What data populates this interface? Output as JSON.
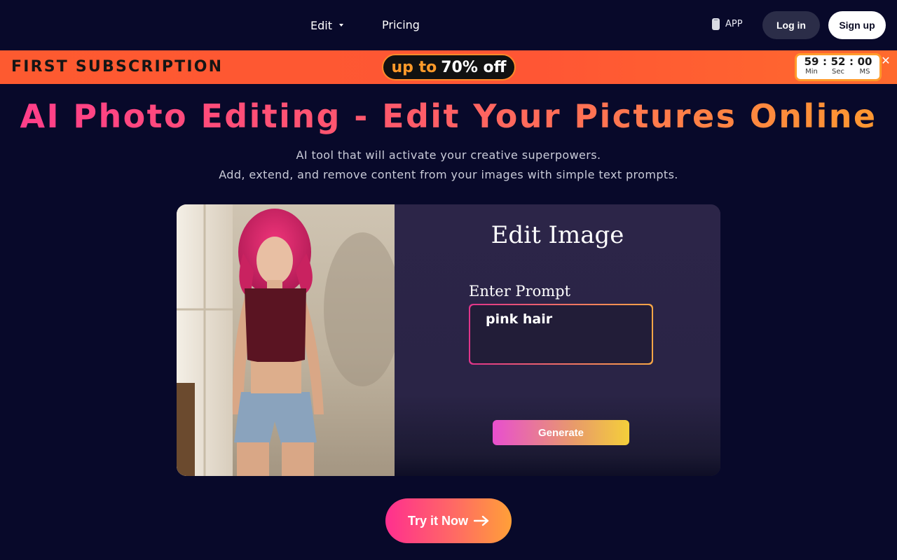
{
  "nav": {
    "edit_label": "Edit",
    "pricing_label": "Pricing",
    "app_label": "APP",
    "login_label": "Log in",
    "signup_label": "Sign up"
  },
  "promo": {
    "title": "FIRST SUBSCRIPTION",
    "pill_prefix": "up to",
    "pill_offer": "70% off",
    "timer": {
      "min": "59",
      "sec": "52",
      "ms": "00",
      "min_label": "Min",
      "sec_label": "Sec",
      "ms_label": "MS"
    },
    "close_symbol": "✕"
  },
  "hero": {
    "title": "AI Photo Editing - Edit Your Pictures Online",
    "subtitle_line1": "AI tool that will activate your creative superpowers.",
    "subtitle_line2": "Add, extend, and remove content from your images with simple text prompts."
  },
  "demo": {
    "panel_title": "Edit Image",
    "prompt_label": "Enter Prompt",
    "prompt_value": "pink hair",
    "generate_label": "Generate"
  },
  "cta": {
    "label": "Try it Now"
  },
  "colors": {
    "background": "#08092a",
    "promo_orange": "#ff5634",
    "title_pink": "#ff3d8b",
    "title_orange": "#ff9a2e"
  }
}
